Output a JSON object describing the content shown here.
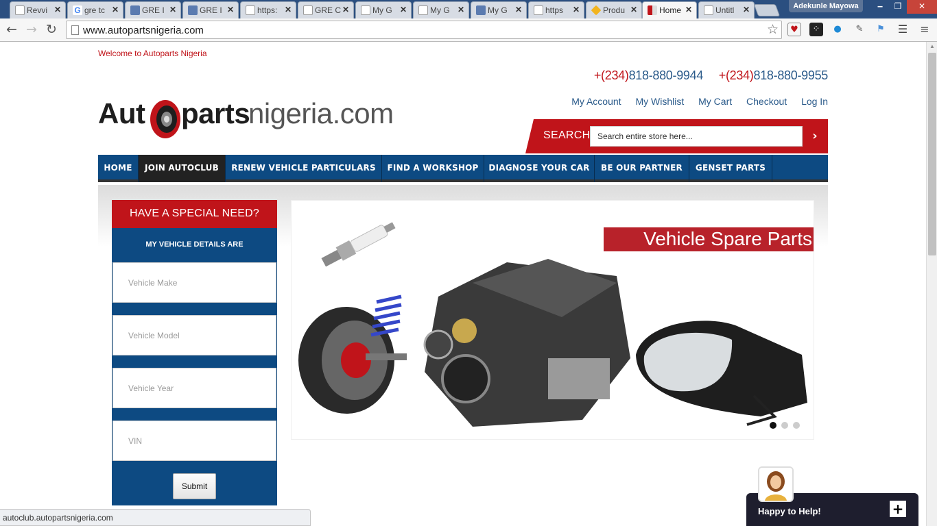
{
  "browser": {
    "tabs": [
      {
        "label": "Revvi",
        "color": "#e9b44c"
      },
      {
        "label": "gre tc",
        "color": "#4285f4"
      },
      {
        "label": "GRE I",
        "color": "#5b7bb0"
      },
      {
        "label": "GRE I",
        "color": "#5b7bb0"
      },
      {
        "label": "https:",
        "color": "#ffffff"
      },
      {
        "label": "GRE C",
        "color": "#ffffff"
      },
      {
        "label": "My G",
        "color": "#ffffff"
      },
      {
        "label": "My G",
        "color": "#ffffff"
      },
      {
        "label": "My G",
        "color": "#5b7bb0"
      },
      {
        "label": "https",
        "color": "#ffffff"
      },
      {
        "label": "Produ",
        "color": "#f2b41e"
      },
      {
        "label": "Home",
        "color": "#c0141a",
        "active": true
      },
      {
        "label": "Untitl",
        "color": "#ffffff"
      }
    ],
    "profile_name": "Adekunle Mayowa",
    "url": "www.autopartsnigeria.com",
    "status_url": "autoclub.autopartsnigeria.com"
  },
  "site": {
    "welcome": "Welcome to Autoparts Nigeria",
    "phone1_code": "+(234)",
    "phone1_number": "818-880-9944",
    "phone2_code": "+(234)",
    "phone2_number": "818-880-9955",
    "logo": {
      "part1": "Aut",
      "part2": "parts",
      "part3": "nigeria.com"
    },
    "top_links": [
      "My Account",
      "My Wishlist",
      "My Cart",
      "Checkout",
      "Log In"
    ],
    "search": {
      "label": "SEARCH:",
      "placeholder": "Search entire store here..."
    },
    "nav": [
      "HOME",
      "JOIN AUTOCLUB",
      "RENEW VEHICLE PARTICULARS",
      "FIND A WORKSHOP",
      "DIAGNOSE YOUR CAR",
      "BE OUR PARTNER",
      "GENSET PARTS"
    ],
    "special_need": {
      "title": "HAVE A SPECIAL NEED?",
      "subtitle": "MY VEHICLE DETAILS ARE",
      "fields": [
        "Vehicle Make",
        "Vehicle Model",
        "Vehicle Year",
        "VIN"
      ],
      "submit": "Submit"
    },
    "banner": {
      "title": "Vehicle Spare Parts",
      "active_slide": 1,
      "slide_count": 3
    },
    "chat": {
      "label": "Happy to Help!"
    }
  },
  "colors": {
    "brand_red": "#c0141a",
    "nav_blue": "#0d4a82",
    "link_blue": "#2a5a8a"
  }
}
